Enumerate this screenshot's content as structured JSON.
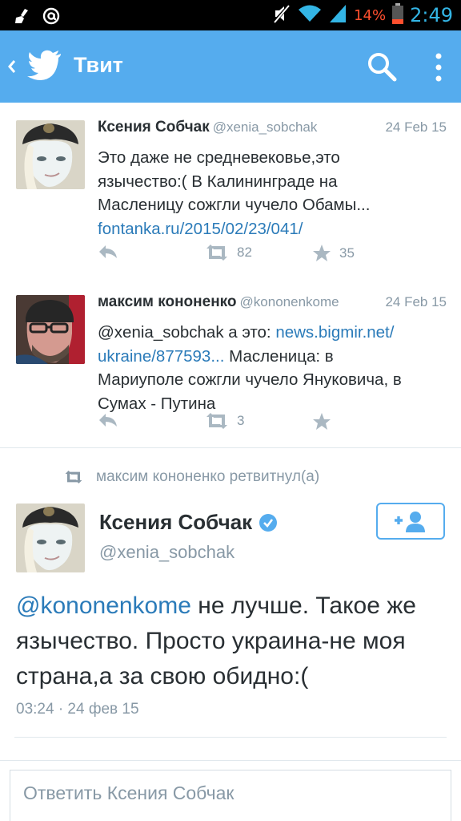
{
  "statusbar": {
    "battery": "14%",
    "time": "2:49",
    "left_icons": [
      "broom-icon",
      "at-sign-icon"
    ],
    "right_icons": [
      "mute-icon",
      "wifi-icon",
      "signal-icon",
      "battery-icon"
    ]
  },
  "actionbar": {
    "title": "Твит",
    "back_icon": "chevron-left-icon",
    "logo_icon": "twitter-bird-icon",
    "search_icon": "search-icon",
    "menu_icon": "overflow-menu-icon",
    "color": "#55acee"
  },
  "tweets": [
    {
      "name": "Ксения Собчак",
      "handle": "@xenia_sobchak",
      "date": "24 Feb 15",
      "text_lines": [
        "Это даже не средневековье,это",
        "язычество:( В Калининграде на",
        "Масленицу сожгли чучело Обамы..."
      ],
      "link": "fontanka.ru/2015/02/23/041/",
      "retweets": "82",
      "favorites": "35"
    },
    {
      "name": "максим кононенко",
      "handle": "@kononenkome",
      "date": "24 Feb 15",
      "text_prefix": "@xenia_sobchak а это: ",
      "link_line1": "news.bigmir.net/",
      "link_line2": "ukraine/877593...",
      "text_suffix": " Масленица: в",
      "text_lines": [
        "Мариуполе сожгли чучело Януковича, в",
        "Сумах - Путина"
      ],
      "retweets": "3",
      "favorites": ""
    }
  ],
  "retweet_notice": "максим кононенко ретвитнул(а)",
  "detail": {
    "name": "Ксения Собчак",
    "handle": "@xenia_sobchak",
    "mention": "@kononenkome",
    "text_after_mention": " не лучше. Такое же язычество. Просто украина-не моя страна,а за свою обидно:(",
    "timestamp": "03:24 · 24 фев 15",
    "verified_icon": "verified-badge-icon",
    "follow_icon": "add-user-icon"
  },
  "reply": {
    "placeholder": "Ответить Ксения Собчак"
  },
  "colors": {
    "link": "#2b7bb9",
    "muted": "#8899a6",
    "text": "#292f33",
    "battery_low": "#ff4f2e",
    "clock": "#33b5e5"
  }
}
